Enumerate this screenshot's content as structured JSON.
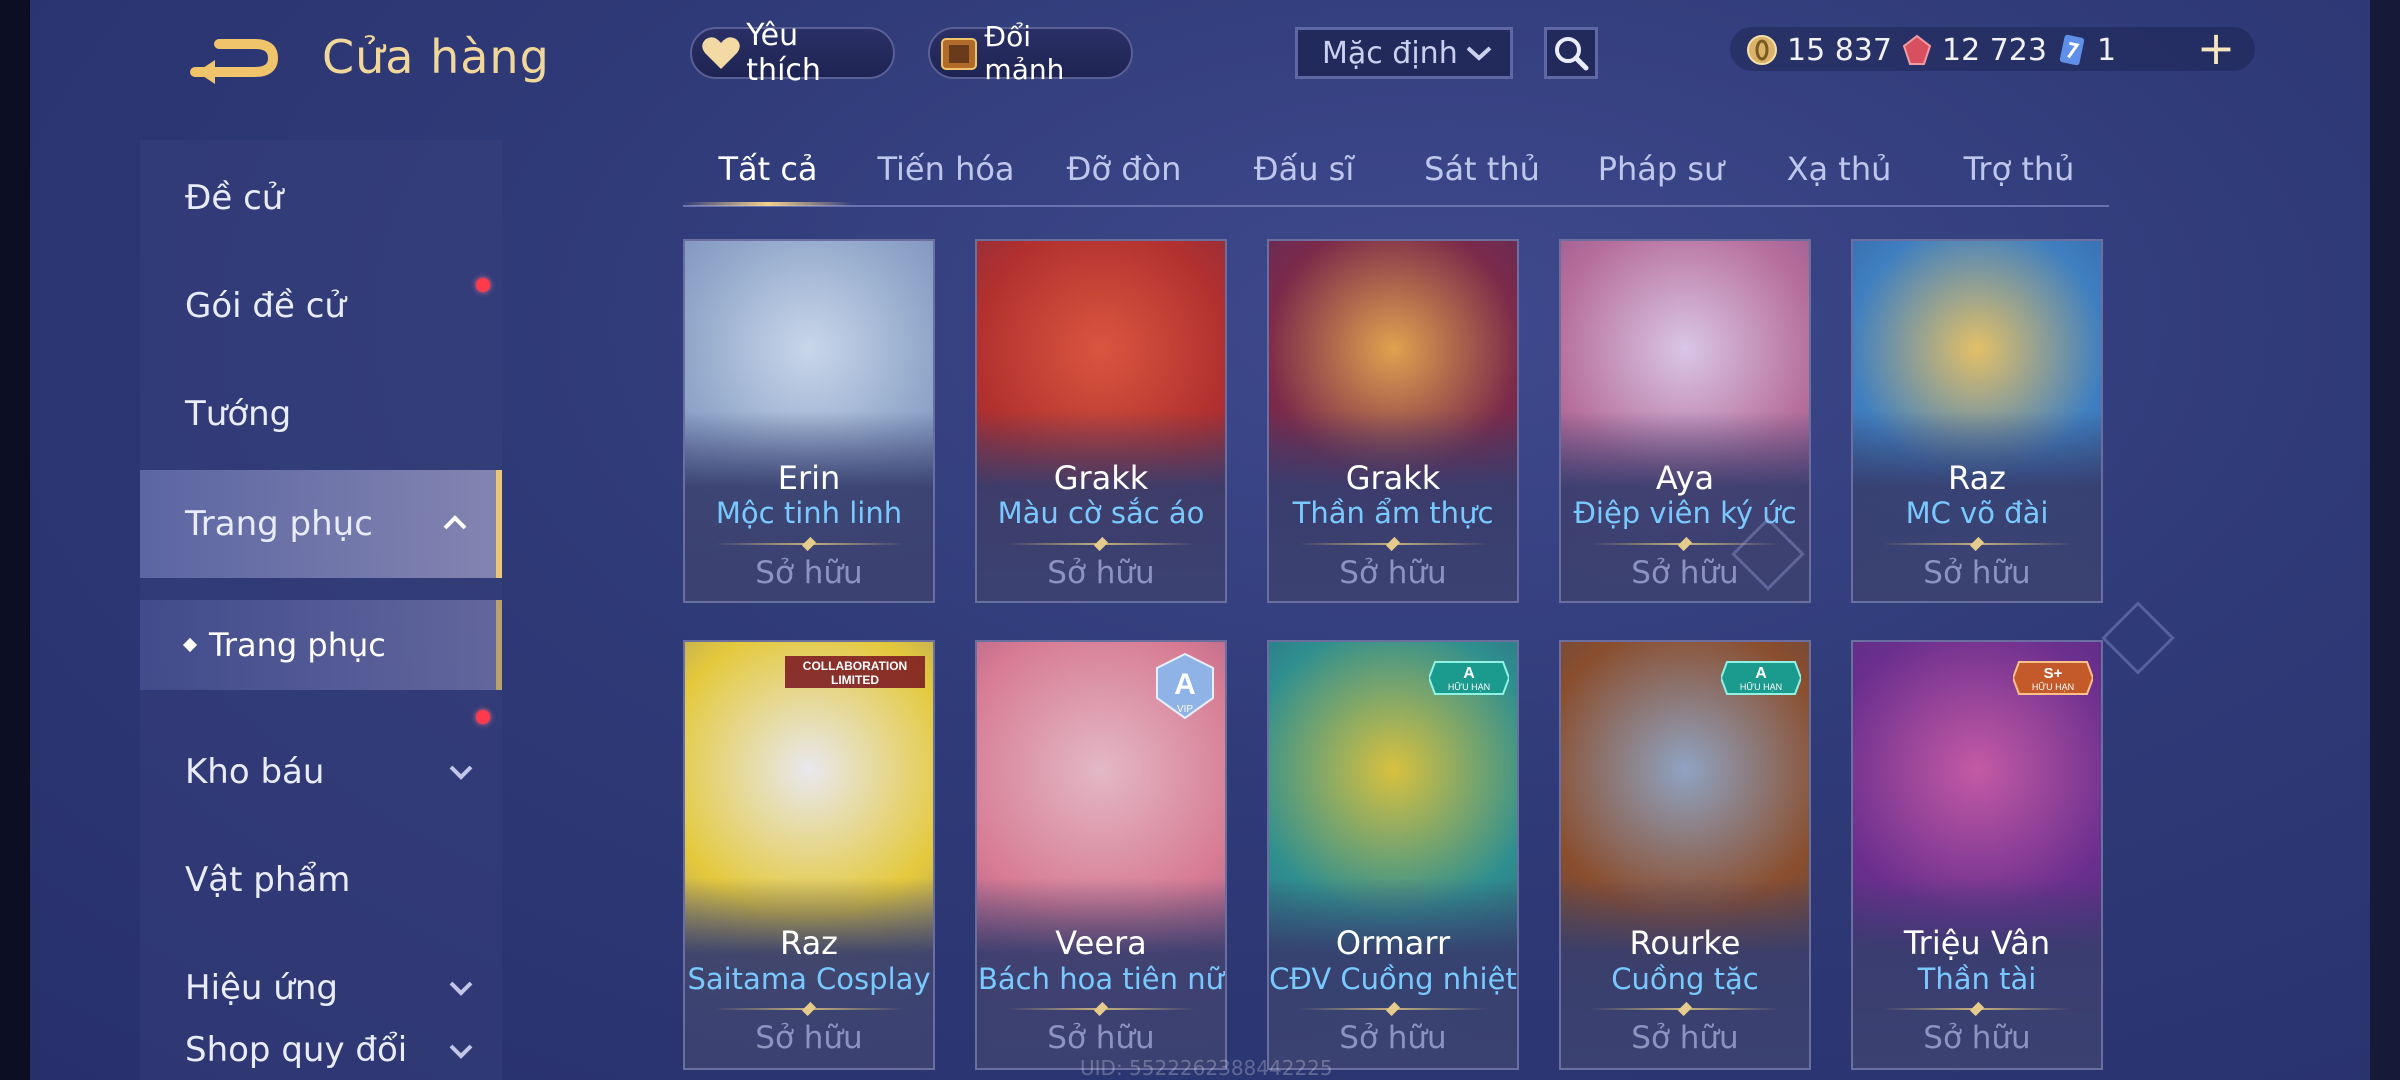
{
  "header": {
    "title": "Cửa hàng",
    "favorite_label": "Yêu thích",
    "fragment_label": "Đổi mảnh",
    "sort_value": "Mặc định",
    "currencies": [
      {
        "name": "gold-coin-icon",
        "value": "15 837"
      },
      {
        "name": "ruby-icon",
        "value": "12 723"
      },
      {
        "name": "card-icon",
        "value": "1"
      }
    ]
  },
  "sidebar": {
    "items": [
      {
        "label": "Đề cử"
      },
      {
        "label": "Gói đề cử"
      },
      {
        "label": "Tướng"
      },
      {
        "label": "Trang phục"
      },
      {
        "label": "Kho báu"
      },
      {
        "label": "Vật phẩm"
      },
      {
        "label": "Hiệu ứng"
      },
      {
        "label": "Shop quy đổi"
      }
    ],
    "sub_item": "Trang phục"
  },
  "tabs": [
    "Tất cả",
    "Tiến hóa",
    "Đỡ đòn",
    "Đấu sĩ",
    "Sát thủ",
    "Pháp sư",
    "Xạ thủ",
    "Trợ thủ"
  ],
  "cards": [
    {
      "hero": "Erin",
      "skin": "Mộc tinh linh",
      "status": "Sở hữu",
      "colors": [
        "#c9d6ea",
        "#8fa6c9",
        "#5f6fa8"
      ]
    },
    {
      "hero": "Grakk",
      "skin": "Màu cờ sắc áo",
      "status": "Sở hữu",
      "colors": [
        "#d9573f",
        "#b1302f",
        "#5a2a52"
      ]
    },
    {
      "hero": "Grakk",
      "skin": "Thần ẩm thực",
      "status": "Sở hữu",
      "colors": [
        "#e0a24f",
        "#7b2a4a",
        "#3b2f6b"
      ]
    },
    {
      "hero": "Aya",
      "skin": "Điệp viên ký ức",
      "status": "Sở hữu",
      "colors": [
        "#d9c6e6",
        "#b7709d",
        "#6b3a7a"
      ]
    },
    {
      "hero": "Raz",
      "skin": "MC võ đài",
      "status": "Sở hữu",
      "colors": [
        "#e3c067",
        "#3f7fc0",
        "#2b4a8a"
      ]
    },
    {
      "hero": "Raz",
      "skin": "Saitama Cosplay",
      "status": "Sở hữu",
      "colors": [
        "#e8e8ee",
        "#e4c93c",
        "#5a5f9a"
      ],
      "badge": "COLLABORATION LIMITED"
    },
    {
      "hero": "Veera",
      "skin": "Bách hoa tiên nữ",
      "status": "Sở hữu",
      "colors": [
        "#e3b8c6",
        "#d77b93",
        "#6c3f7e"
      ],
      "badge": "A VIP"
    },
    {
      "hero": "Ormarr",
      "skin": "CĐV Cuồng nhiệt",
      "status": "Sở hữu",
      "colors": [
        "#d8c13f",
        "#2f8f8f",
        "#2b3f6e"
      ],
      "badge": "A HỮU HẠN"
    },
    {
      "hero": "Rourke",
      "skin": "Cuồng tặc",
      "status": "Sở hữu",
      "colors": [
        "#8fa3c2",
        "#8a4e2e",
        "#333a5c"
      ],
      "badge": "A HỮU HẠN"
    },
    {
      "hero": "Triệu Vân",
      "skin": "Thần tài",
      "status": "Sở hữu",
      "colors": [
        "#c45aa5",
        "#6b2f8e",
        "#3a2c6c"
      ],
      "badge": "S+ HỮU HẠN"
    }
  ],
  "uid_text": "UID: 5522262388442225"
}
